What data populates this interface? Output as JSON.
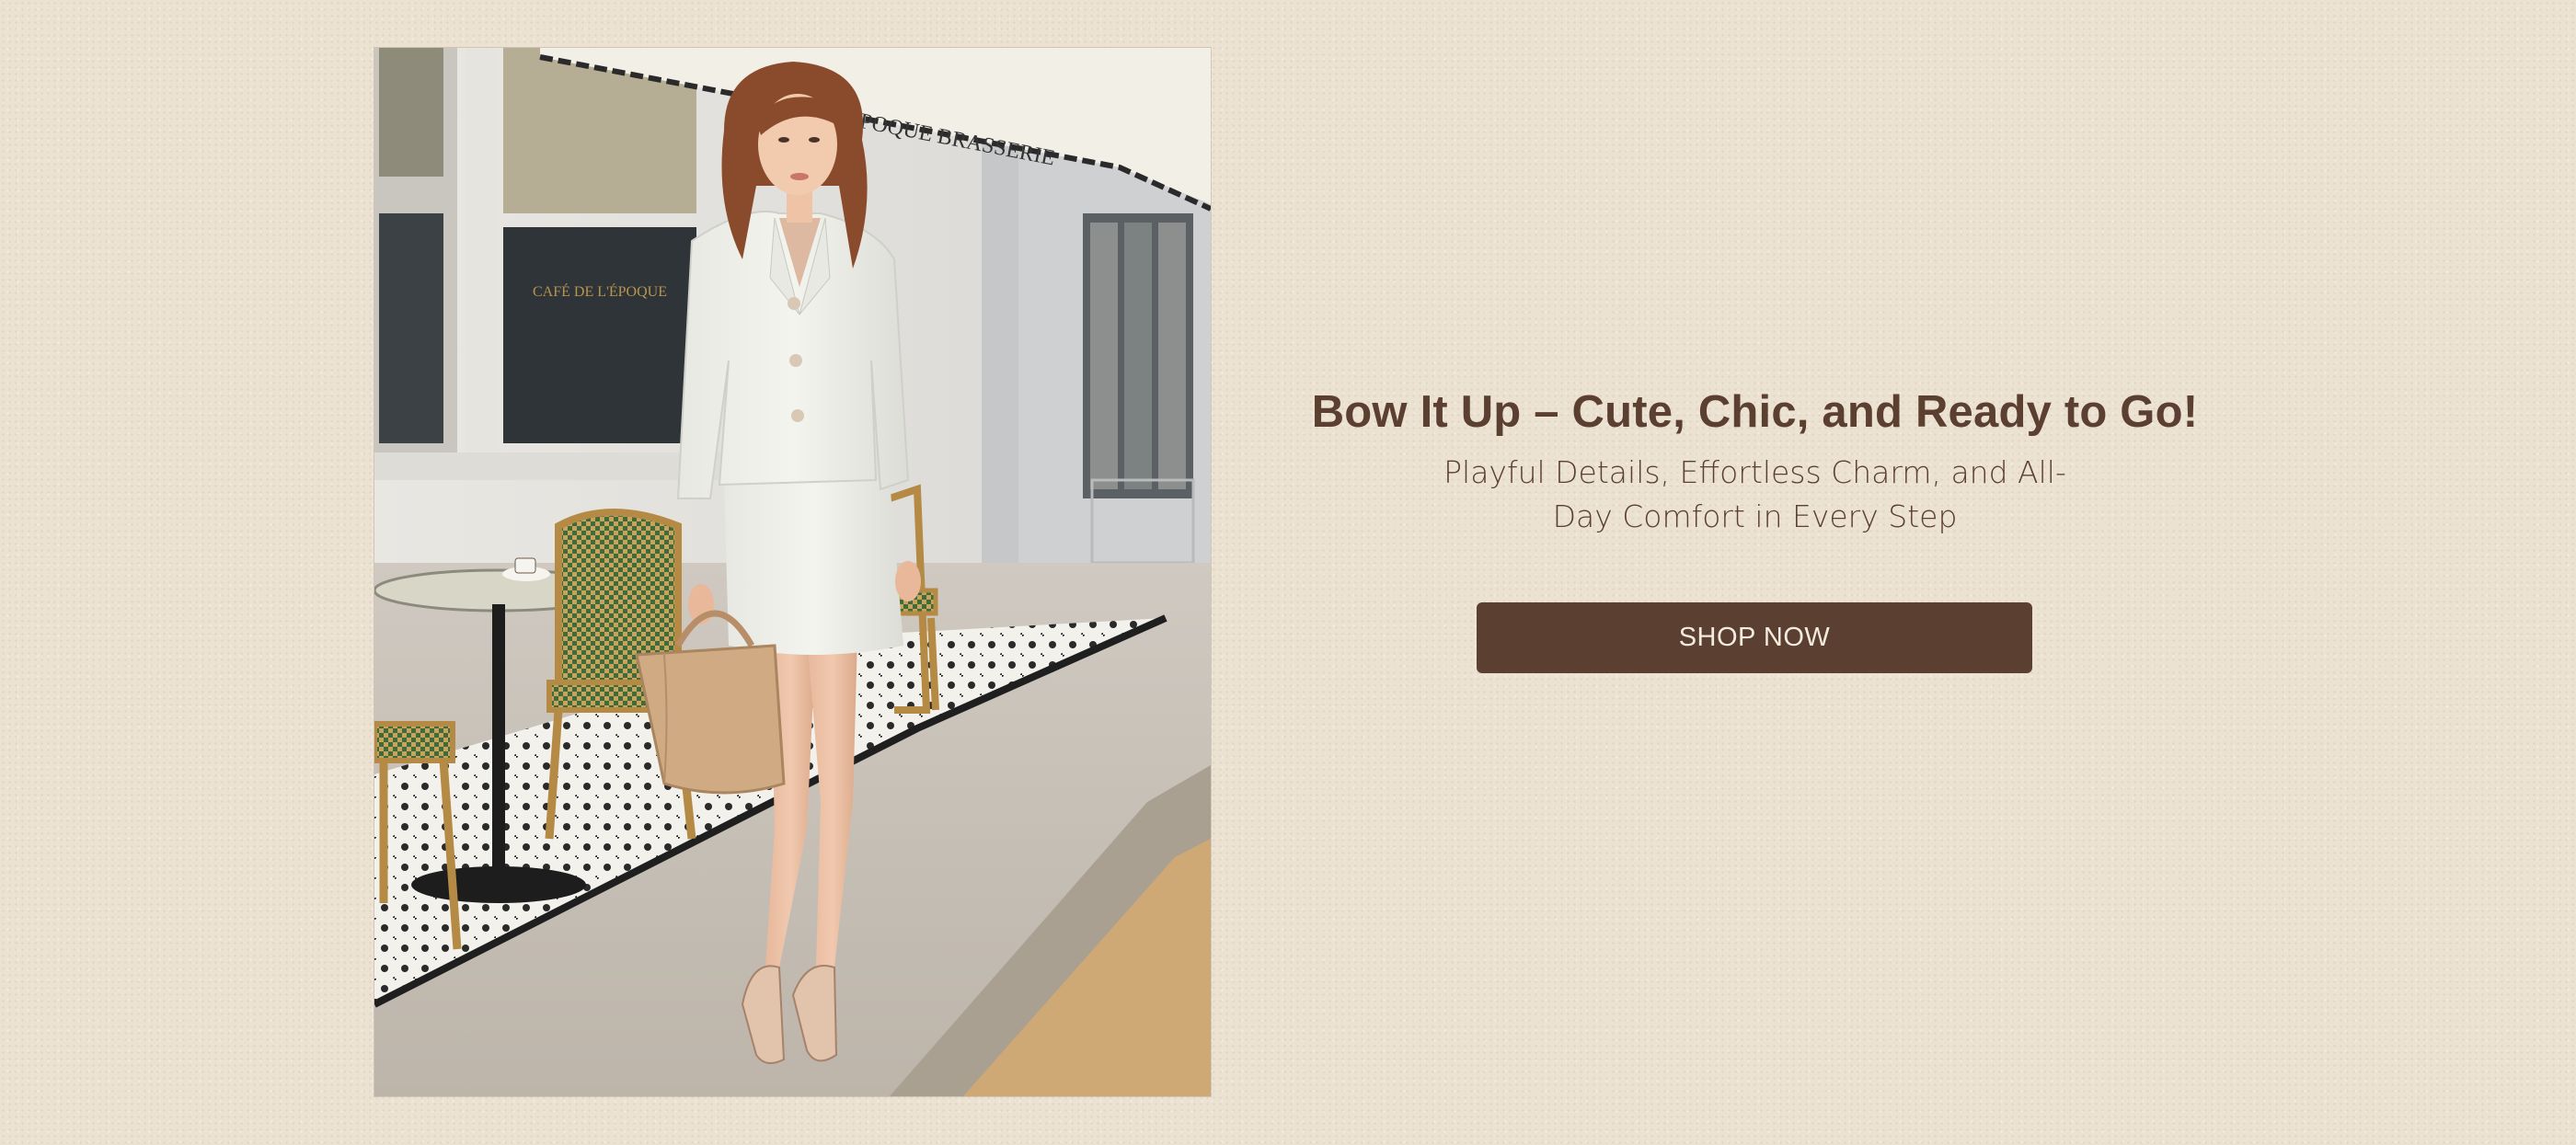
{
  "hero": {
    "image_alt": "Model in white tweed skirt suit with tan handbag outside a Paris café",
    "awning_text": "CAFÉ DE L'ÉPOQUE  BRASSERIE",
    "window_text": "CAFÉ DE L'ÉPOQUE"
  },
  "promo": {
    "headline": "Bow It Up – Cute, Chic, and Ready to Go!",
    "subhead": "Playful  Details,  Effortless Charm, and All-Day Comfort in  Every Step",
    "cta_label": "SHOP NOW"
  },
  "colors": {
    "background": "#ece2d2",
    "text": "#5b3f31",
    "button": "#5b3f31",
    "button_text": "#f3ebe0"
  }
}
